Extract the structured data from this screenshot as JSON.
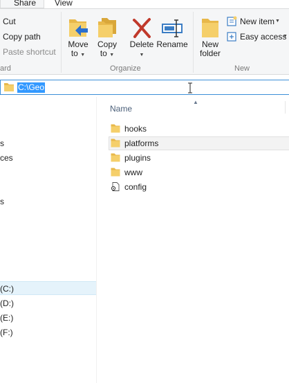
{
  "tabs": [
    {
      "label": "Share"
    },
    {
      "label": "View"
    }
  ],
  "ribbon": {
    "clipboard": {
      "cut": "Cut",
      "copy_path": "Copy path",
      "paste_shortcut": "Paste shortcut",
      "group_label": "ard"
    },
    "organize": {
      "move_to_1": "Move",
      "move_to_2": "to",
      "copy_to_1": "Copy",
      "copy_to_2": "to",
      "delete": "Delete",
      "rename": "Rename",
      "group_label": "Organize"
    },
    "new": {
      "new_folder_1": "New",
      "new_folder_2": "folder",
      "new_item": "New item",
      "easy_access": "Easy access",
      "group_label": "New"
    }
  },
  "address": {
    "path": "C:\\Geo"
  },
  "nav": {
    "items": [
      "s",
      "ces",
      "s",
      "(C:)",
      "(D:)",
      "(E:)",
      "(F:)"
    ],
    "selected": "(C:)"
  },
  "files": {
    "column_name": "Name",
    "rows": [
      {
        "name": "hooks",
        "type": "folder"
      },
      {
        "name": "platforms",
        "type": "folder"
      },
      {
        "name": "plugins",
        "type": "folder"
      },
      {
        "name": "www",
        "type": "folder"
      },
      {
        "name": "config",
        "type": "file"
      }
    ],
    "hovered": "platforms"
  },
  "colors": {
    "accent": "#3399ff",
    "address_border": "#3c8fd8",
    "folder": "#e8b84a",
    "ribbon_bg": "#f5f6f7",
    "selection_bg": "#e5f3fb"
  }
}
